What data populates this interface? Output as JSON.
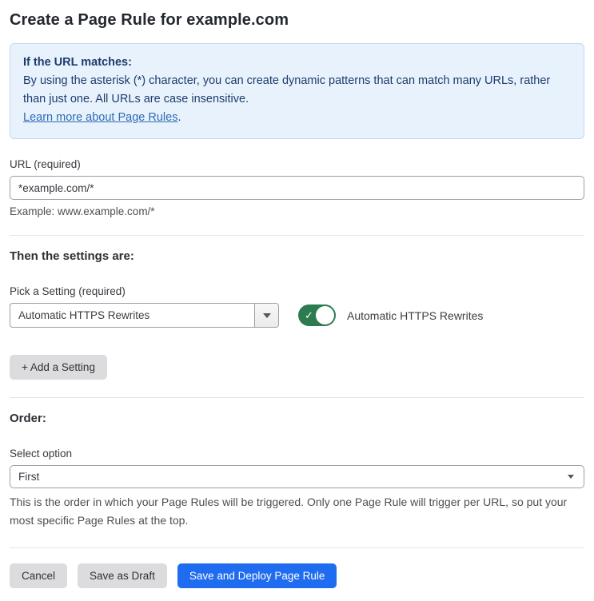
{
  "page": {
    "title": "Create a Page Rule for example.com"
  },
  "info_box": {
    "heading": "If the URL matches:",
    "body": "By using the asterisk (*) character, you can create dynamic patterns that can match many URLs, rather than just one. All URLs are case insensitive.",
    "link_label": "Learn more about Page Rules",
    "link_suffix": "."
  },
  "url_field": {
    "label": "URL (required)",
    "value": "*example.com/*",
    "helper": "Example: www.example.com/*"
  },
  "settings_section": {
    "heading": "Then the settings are:",
    "picker_label": "Pick a Setting (required)",
    "picker_value": "Automatic HTTPS Rewrites",
    "toggle_label": "Automatic HTTPS Rewrites",
    "toggle_state": "on",
    "toggle_check_glyph": "✓",
    "add_setting_label": "+ Add a Setting"
  },
  "order_section": {
    "heading": "Order:",
    "select_label": "Select option",
    "select_value": "First",
    "helper": "This is the order in which your Page Rules will be triggered. Only one Page Rule will trigger per URL, so put your most specific Page Rules at the top."
  },
  "footer": {
    "cancel_label": "Cancel",
    "save_draft_label": "Save as Draft",
    "save_deploy_label": "Save and Deploy Page Rule"
  },
  "colors": {
    "info_bg": "#e8f2fc",
    "info_border": "#bed9f2",
    "info_text": "#1d3c6d",
    "link": "#2d6cb5",
    "toggle_on": "#2c7c50",
    "primary_button": "#1f6cf1",
    "secondary_button": "#dcdcde",
    "body_text": "#36393f"
  }
}
